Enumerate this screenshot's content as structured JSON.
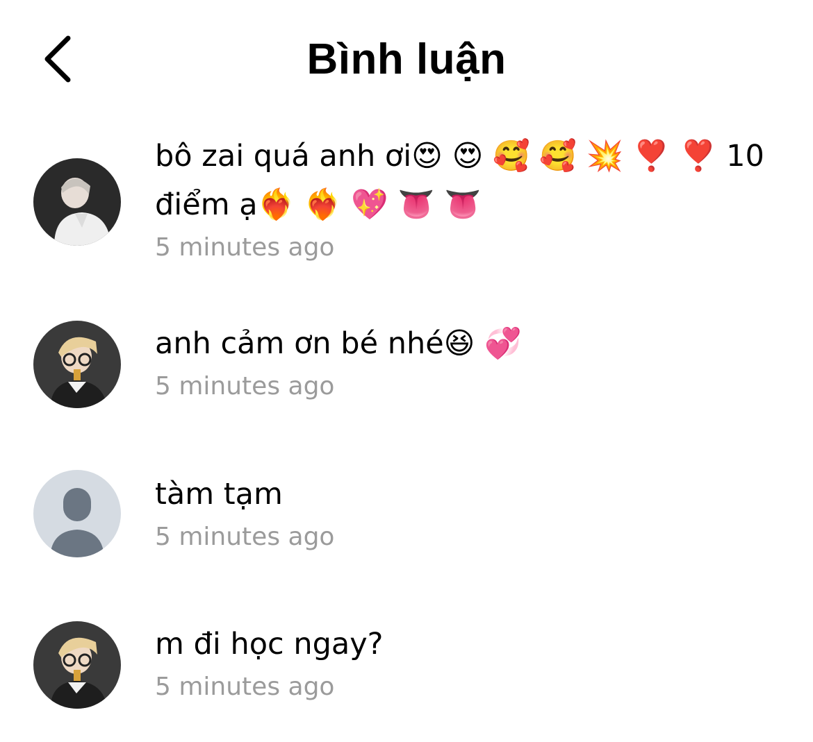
{
  "header": {
    "title": "Bình luận",
    "back_icon": "chevron-left-icon"
  },
  "comments": [
    {
      "avatar": "user-photo-avatar",
      "text": "bô zai quá anh ơi😍 😍 🥰 🥰 💥 ❣️ ❣️ 10 điểm ạ❤️‍🔥 ❤️‍🔥 💖 👅 👅",
      "time": "5 minutes ago"
    },
    {
      "avatar": "user-photo-avatar",
      "text": "anh cảm ơn bé nhé😆 💞",
      "time": "5 minutes ago"
    },
    {
      "avatar": "default-person-avatar",
      "text": "tàm tạm",
      "time": "5 minutes ago"
    },
    {
      "avatar": "user-photo-avatar",
      "text": "m đi học ngay?",
      "time": "5 minutes ago"
    }
  ],
  "colors": {
    "time_text": "#9b9b9b",
    "default_avatar_bg": "#d5dbe2",
    "default_avatar_figure": "#6b7683"
  }
}
